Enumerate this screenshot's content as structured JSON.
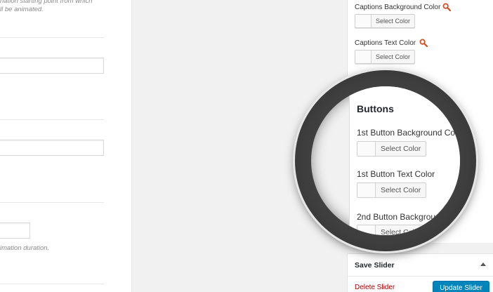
{
  "left_panel": {
    "help_top_line1": "nation starting point from which",
    "help_top_line2": "ll be animated.",
    "help_bottom": "imation duration."
  },
  "sidebar": {
    "captions_bg_label": "Captions Background Color",
    "captions_text_label": "Captions Text Color",
    "select_color_label": "Select Color",
    "search_icon_color": "#d54e21"
  },
  "magnifier": {
    "heading": "Buttons",
    "btn1_bg_label": "1st Button Background Colo",
    "btn1_text_label": "1st Button Text Color",
    "btn2_bg_label": "2nd Button Backgrou",
    "select_color_label": "Select Color"
  },
  "save_box": {
    "title": "Save Slider",
    "delete_label": "Delete Slider",
    "update_label": "Update Slider",
    "update_color": "#0085ba"
  }
}
